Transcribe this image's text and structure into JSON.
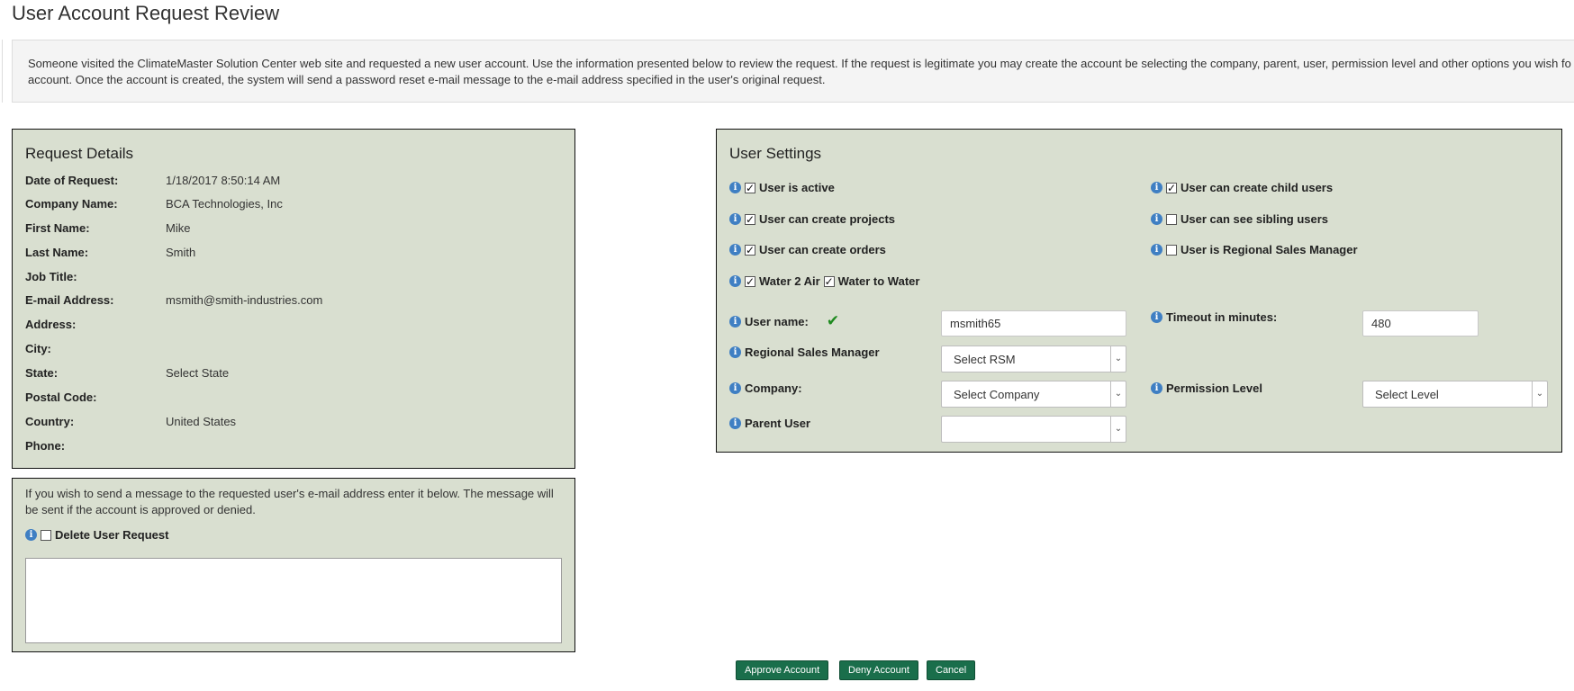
{
  "page": {
    "title": "User Account Request Review",
    "intro_line1": "Someone visited the ClimateMaster Solution Center web site and requested a new user account. Use the information presented below to review the request. If the request is legitimate you may create the account be selecting the company, parent, user, permission level and other options you wish fo",
    "intro_line2": "account. Once the account is created, the system will send a password reset e-mail message to the e-mail address specified in the user's original request."
  },
  "request_details": {
    "title": "Request Details",
    "rows": [
      {
        "label": "Date of Request:",
        "value": "1/18/2017 8:50:14 AM"
      },
      {
        "label": "Company Name:",
        "value": "BCA Technologies, Inc"
      },
      {
        "label": "First Name:",
        "value": "Mike"
      },
      {
        "label": "Last Name:",
        "value": "Smith"
      },
      {
        "label": "Job Title:",
        "value": ""
      },
      {
        "label": "E-mail Address:",
        "value": "msmith@smith-industries.com"
      },
      {
        "label": "Address:",
        "value": ""
      },
      {
        "label": "City:",
        "value": ""
      },
      {
        "label": "State:",
        "value": "Select State"
      },
      {
        "label": "Postal Code:",
        "value": ""
      },
      {
        "label": "Country:",
        "value": "United States"
      },
      {
        "label": "Phone:",
        "value": ""
      }
    ]
  },
  "message": {
    "text": "If you wish to send a message to the requested user's e-mail address enter it below. The message will be sent if the account is approved or denied.",
    "delete_label": "Delete User Request",
    "delete_checked": false,
    "textarea_value": ""
  },
  "settings": {
    "title": "User Settings",
    "checks": {
      "active": {
        "label": "User is active",
        "checked": true
      },
      "create_projects": {
        "label": "User can create projects",
        "checked": true
      },
      "create_orders": {
        "label": "User can create orders",
        "checked": true
      },
      "water2air": {
        "label": "Water 2 Air",
        "checked": true
      },
      "water2water": {
        "label": "Water to Water",
        "checked": true
      },
      "child_users": {
        "label": "User can create child users",
        "checked": true
      },
      "sibling_users": {
        "label": "User can see sibling users",
        "checked": false
      },
      "regional_mgr": {
        "label": "User is Regional Sales Manager",
        "checked": false
      }
    },
    "username_label": "User name:",
    "username_value": "msmith65",
    "timeout_label": "Timeout in minutes:",
    "timeout_value": "480",
    "rsm_label": "Regional Sales Manager",
    "rsm_selected": "Select RSM",
    "company_label": "Company:",
    "company_selected": "Select Company",
    "permission_label": "Permission Level",
    "permission_selected": "Select Level",
    "parent_label": "Parent User",
    "parent_selected": ""
  },
  "buttons": {
    "approve": "Approve Account",
    "deny": "Deny Account",
    "cancel": "Cancel"
  },
  "colors": {
    "panel_bg": "#d9dfd0",
    "button_bg": "#1a6e4b",
    "info_icon": "#3f7fc3",
    "ok_check": "#1f8a1f"
  },
  "icons": {
    "info": "info-icon",
    "ok": "checkmark-icon",
    "dropdown": "chevron-down-icon"
  }
}
